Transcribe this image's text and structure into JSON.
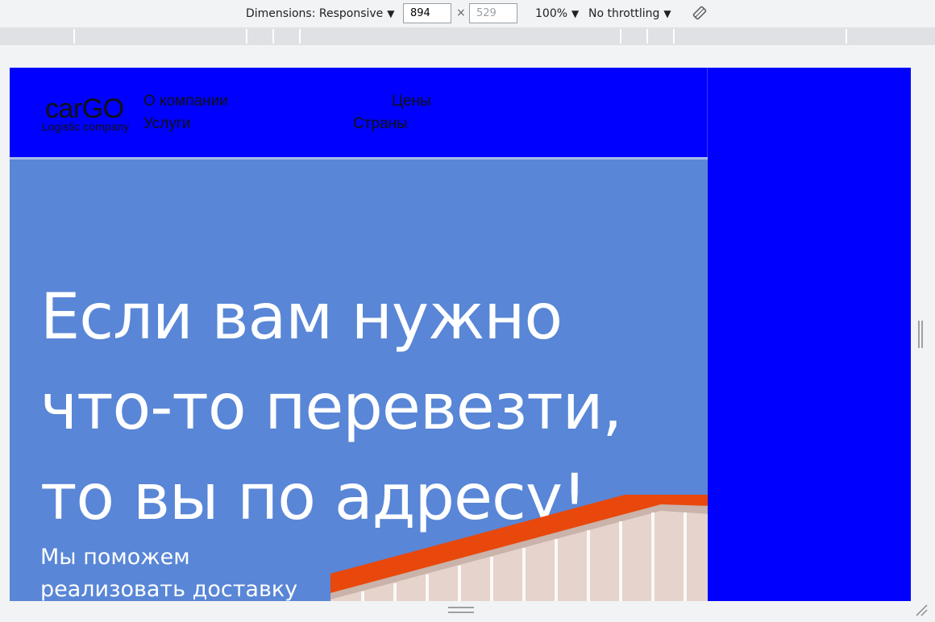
{
  "devtools": {
    "dimensions_label": "Dimensions: Responsive",
    "width_value": "894",
    "height_placeholder": "529",
    "times_symbol": "×",
    "zoom_label": "100%",
    "throttling_label": "No throttling",
    "caret": "▼"
  },
  "site": {
    "logo_text": "carGO",
    "logo_subtitle": "Logistic company",
    "nav": {
      "about": "О компании",
      "prices": "Цены",
      "services": "Услуги",
      "countries": "Страны"
    },
    "hero": {
      "title_line1": "Если вам нужно",
      "title_line2": "что-то перевезти,",
      "title_line3": "то вы по адресу!",
      "subtitle_line1": "Мы поможем",
      "subtitle_line2": "реализовать доставку"
    }
  },
  "colors": {
    "page_bg": "#0000ff",
    "hero_bg": "#5986d6",
    "container_roof": "#e8480c",
    "container_body": "#e5d3cc"
  }
}
